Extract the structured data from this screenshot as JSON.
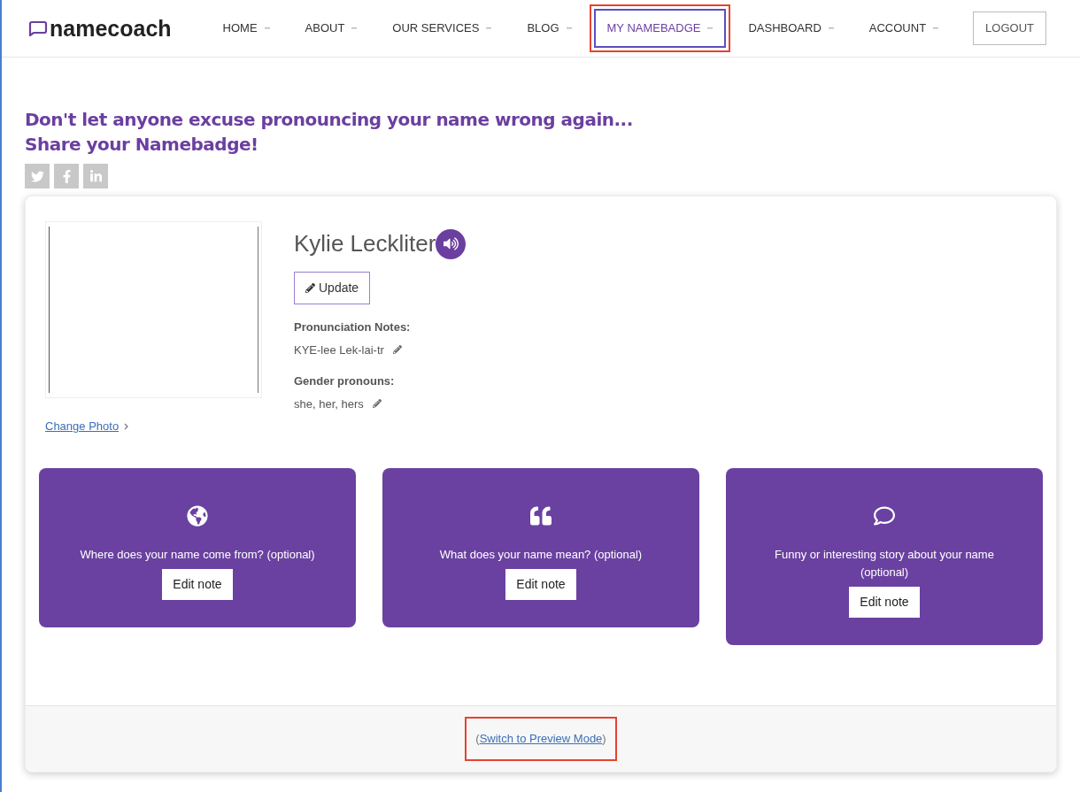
{
  "logo": "namecoach",
  "nav": [
    {
      "label": "HOME",
      "selected": false,
      "highlighted": false
    },
    {
      "label": "ABOUT",
      "selected": false,
      "highlighted": false
    },
    {
      "label": "OUR SERVICES",
      "selected": false,
      "highlighted": false
    },
    {
      "label": "BLOG",
      "selected": false,
      "highlighted": false
    },
    {
      "label": "MY NAMEBADGE",
      "selected": true,
      "highlighted": true
    },
    {
      "label": "DASHBOARD",
      "selected": false,
      "highlighted": false
    },
    {
      "label": "ACCOUNT",
      "selected": false,
      "highlighted": false
    }
  ],
  "logout": "LOGOUT",
  "headline": [
    "Don't let anyone excuse pronouncing your name wrong again...",
    "Share your Namebadge!"
  ],
  "share": [
    {
      "kind": "twitter"
    },
    {
      "kind": "facebook"
    },
    {
      "kind": "linkedin"
    }
  ],
  "profile": {
    "name": "Kylie Leckliter",
    "update": "Update",
    "change_photo": "Change Photo",
    "fields": [
      {
        "label": "Pronunciation Notes:",
        "value": "KYE-lee Lek-lai-tr"
      },
      {
        "label": "Gender pronouns:",
        "value": "she, her, hers"
      }
    ]
  },
  "notes": [
    {
      "kind": "globe",
      "text": "Where does your name come from? (optional)",
      "button": "Edit note"
    },
    {
      "kind": "quote",
      "text": "What does your name mean? (optional)",
      "button": "Edit note"
    },
    {
      "kind": "chat",
      "text": "Funny or interesting story about your name (optional)",
      "button": "Edit note"
    }
  ],
  "footer": {
    "open": "(",
    "link": "Switch to Preview Mode",
    "close": ")",
    "highlighted": true
  }
}
